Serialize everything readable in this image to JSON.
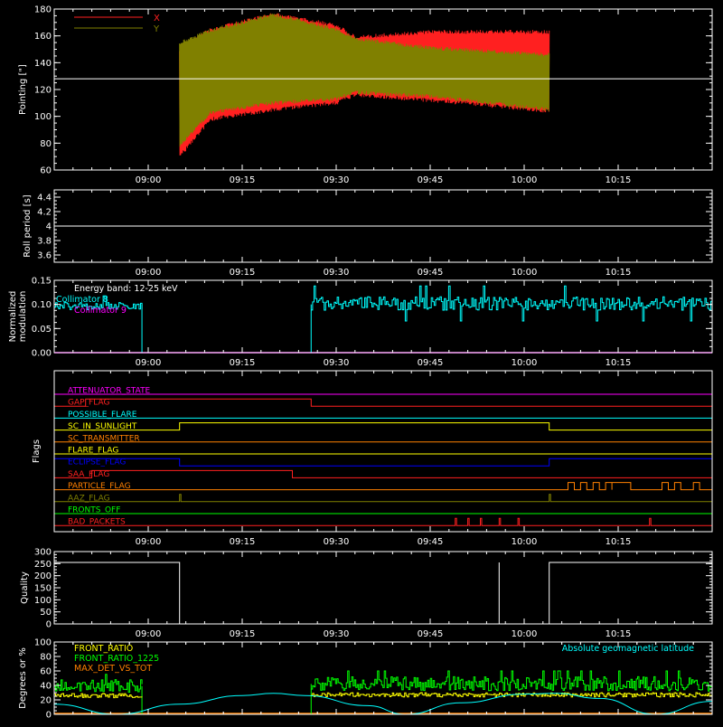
{
  "time_axis": {
    "range_min": [
      8.75,
      10.5
    ],
    "ticks": [
      {
        "t": 9.0,
        "label": "09:00"
      },
      {
        "t": 9.25,
        "label": "09:15"
      },
      {
        "t": 9.5,
        "label": "09:30"
      },
      {
        "t": 9.75,
        "label": "09:45"
      },
      {
        "t": 10.0,
        "label": "10:00"
      },
      {
        "t": 10.25,
        "label": "10:15"
      }
    ]
  },
  "chart_data": [
    {
      "type": "line",
      "id": "pointing",
      "ylabel": "Pointing [\"]",
      "ylim": [
        60,
        180
      ],
      "yticks": [
        60,
        80,
        100,
        120,
        140,
        160,
        180
      ],
      "reference_line": 128,
      "data_span": [
        "09:05",
        "10:04"
      ],
      "legend_placement": "top-left",
      "series": [
        {
          "name": "X",
          "color": "#ff2020",
          "envelope": [
            {
              "t": "09:05",
              "min": 70,
              "max": 150
            },
            {
              "t": "09:10",
              "min": 98,
              "max": 165
            },
            {
              "t": "09:20",
              "min": 105,
              "max": 176
            },
            {
              "t": "09:30",
              "min": 110,
              "max": 168
            },
            {
              "t": "09:33",
              "min": 116,
              "max": 159
            },
            {
              "t": "09:45",
              "min": 112,
              "max": 163
            },
            {
              "t": "10:04",
              "min": 104,
              "max": 163
            }
          ]
        },
        {
          "name": "Y",
          "color": "#808000",
          "envelope": [
            {
              "t": "09:05",
              "min": 78,
              "max": 155
            },
            {
              "t": "09:10",
              "min": 103,
              "max": 164
            },
            {
              "t": "09:20",
              "min": 110,
              "max": 176
            },
            {
              "t": "09:30",
              "min": 113,
              "max": 165
            },
            {
              "t": "09:33",
              "min": 118,
              "max": 158
            },
            {
              "t": "09:45",
              "min": 115,
              "max": 151
            },
            {
              "t": "10:04",
              "min": 105,
              "max": 146
            }
          ]
        }
      ]
    },
    {
      "type": "line",
      "id": "roll_period",
      "ylabel": "Roll period [s]",
      "ylim": [
        3.5,
        4.5
      ],
      "yticks": [
        3.6,
        3.8,
        4.0,
        4.2,
        4.4
      ],
      "series": [
        {
          "name": "",
          "color": "#ffffff",
          "values": [
            {
              "t": "08:45",
              "y": 4.0
            },
            {
              "t": "10:30",
              "y": 4.0
            }
          ]
        }
      ]
    },
    {
      "type": "line",
      "id": "modulation",
      "ylabel_lines": [
        "Normalized",
        "modulation"
      ],
      "ylim": [
        0,
        0.15
      ],
      "yticks": [
        0.0,
        0.05,
        0.1,
        0.15
      ],
      "ytick_labels": [
        "0.00",
        "0.05",
        "0.10",
        "0.15"
      ],
      "annotation": "Energy band: 12-25 keV",
      "series": [
        {
          "name": "Collimator 8",
          "color": "#00ffff",
          "segments": [
            {
              "start": "08:45",
              "end": "08:59",
              "mean": 0.097,
              "spread": 0.008
            },
            {
              "start": "09:26",
              "end": "10:30",
              "mean": 0.102,
              "spread": 0.014
            }
          ],
          "spike_times": [
            "08:59",
            "09:26"
          ]
        },
        {
          "name": "Collimator 9",
          "color": "#ff00ff",
          "values": [
            {
              "t": "08:45",
              "y": 0.0
            },
            {
              "t": "10:30",
              "y": 0.0
            }
          ]
        }
      ]
    },
    {
      "type": "line",
      "id": "flags",
      "ylabel": "Flags",
      "series": [
        {
          "name": "ATTENUATOR_STATE",
          "color": "#ff00ff",
          "steps": []
        },
        {
          "name": "GAP_FLAG",
          "color": "#ff2020",
          "steps": [
            [
              "08:50",
              "09:26"
            ]
          ]
        },
        {
          "name": "POSSIBLE_FLARE",
          "color": "#00ffff",
          "steps": []
        },
        {
          "name": "SC_IN_SUNLIGHT",
          "color": "#ffff00",
          "steps": [
            [
              "09:05",
              "10:04"
            ]
          ]
        },
        {
          "name": "SC_TRANSMITTER",
          "color": "#ff8000",
          "steps": []
        },
        {
          "name": "FLARE_FLAG",
          "color": "#ffff00",
          "steps": []
        },
        {
          "name": "ECLIPSE_FLAG",
          "color": "#0000ff",
          "steps": [
            [
              "08:45",
              "09:05"
            ],
            [
              "10:04",
              "10:30"
            ]
          ]
        },
        {
          "name": "SAA_FLAG",
          "color": "#ff2020",
          "steps": [
            [
              "08:51",
              "09:23"
            ]
          ]
        },
        {
          "name": "PARTICLE_FLAG",
          "color": "#ff8000",
          "steps": [
            [
              "10:07",
              "10:08"
            ],
            [
              "10:09",
              "10:10"
            ],
            [
              "10:11",
              "10:12"
            ],
            [
              "10:13",
              "10:14"
            ],
            [
              "10:14",
              "10:17"
            ],
            [
              "10:22",
              "10:23"
            ],
            [
              "10:24",
              "10:25"
            ],
            [
              "10:27",
              "10:28"
            ]
          ]
        },
        {
          "name": "AAZ_FLAG",
          "color": "#808000",
          "steps": [
            [
              "09:05",
              "09:05"
            ],
            [
              "10:04",
              "10:04"
            ]
          ]
        },
        {
          "name": "FRONTS_OFF",
          "color": "#00ff00",
          "steps": []
        },
        {
          "name": "BAD_PACKETS",
          "color": "#ff2020",
          "steps": [
            [
              "09:49",
              "09:49"
            ],
            [
              "09:51",
              "09:51"
            ],
            [
              "09:53",
              "09:53"
            ],
            [
              "09:56",
              "09:56"
            ],
            [
              "09:59",
              "09:59"
            ],
            [
              "10:20",
              "10:20"
            ]
          ]
        }
      ]
    },
    {
      "type": "line",
      "id": "quality",
      "ylabel": "Quality",
      "ylim": [
        0,
        300
      ],
      "yticks": [
        0,
        50,
        100,
        150,
        200,
        250,
        300
      ],
      "series": [
        {
          "name": "",
          "color": "#ffffff",
          "values": [
            {
              "t": "08:45",
              "y": 255
            },
            {
              "t": "09:05",
              "y": 255
            },
            {
              "t": "09:05",
              "y": 0
            },
            {
              "t": "09:56",
              "y": 0
            },
            {
              "t": "09:56",
              "y": 255
            },
            {
              "t": "09:56",
              "y": 0
            },
            {
              "t": "10:04",
              "y": 0
            },
            {
              "t": "10:04",
              "y": 255
            },
            {
              "t": "10:30",
              "y": 255
            }
          ]
        }
      ]
    },
    {
      "type": "line",
      "id": "ratios",
      "ylabel": "Degrees or %",
      "ylim": [
        0,
        100
      ],
      "yticks": [
        0,
        20,
        40,
        60,
        80,
        100
      ],
      "right_label": "Absolute geomagnetic latitude",
      "right_label_color": "#00ffff",
      "series": [
        {
          "name": "FRONT_RATIO",
          "color": "#ffff00",
          "segments": [
            {
              "start": "08:45",
              "end": "08:59",
              "mean": 26,
              "spread": 3
            },
            {
              "start": "09:26",
              "end": "10:30",
              "mean": 27,
              "spread": 3
            }
          ]
        },
        {
          "name": "FRONT_RATIO_1225",
          "color": "#00ff00",
          "segments": [
            {
              "start": "08:45",
              "end": "08:59",
              "mean": 39,
              "spread": 9
            },
            {
              "start": "09:26",
              "end": "10:30",
              "mean": 42,
              "spread": 10
            }
          ]
        },
        {
          "name": "MAX_DET_VS_TOT",
          "color": "#ff8000",
          "values": [
            {
              "t": "08:45",
              "y": 0
            },
            {
              "t": "10:30",
              "y": 0
            }
          ]
        },
        {
          "name": "",
          "color": "#00ffff",
          "values": [
            {
              "t": "08:45",
              "y": 14
            },
            {
              "t": "08:55",
              "y": 0
            },
            {
              "t": "09:05",
              "y": 14
            },
            {
              "t": "09:15",
              "y": 26
            },
            {
              "t": "09:20",
              "y": 29
            },
            {
              "t": "09:25",
              "y": 26
            },
            {
              "t": "09:35",
              "y": 12
            },
            {
              "t": "09:41",
              "y": 0
            },
            {
              "t": "09:50",
              "y": 16
            },
            {
              "t": "10:00",
              "y": 28
            },
            {
              "t": "10:05",
              "y": 29
            },
            {
              "t": "10:12",
              "y": 22
            },
            {
              "t": "10:21",
              "y": 0
            },
            {
              "t": "10:30",
              "y": 18
            }
          ]
        }
      ]
    }
  ]
}
